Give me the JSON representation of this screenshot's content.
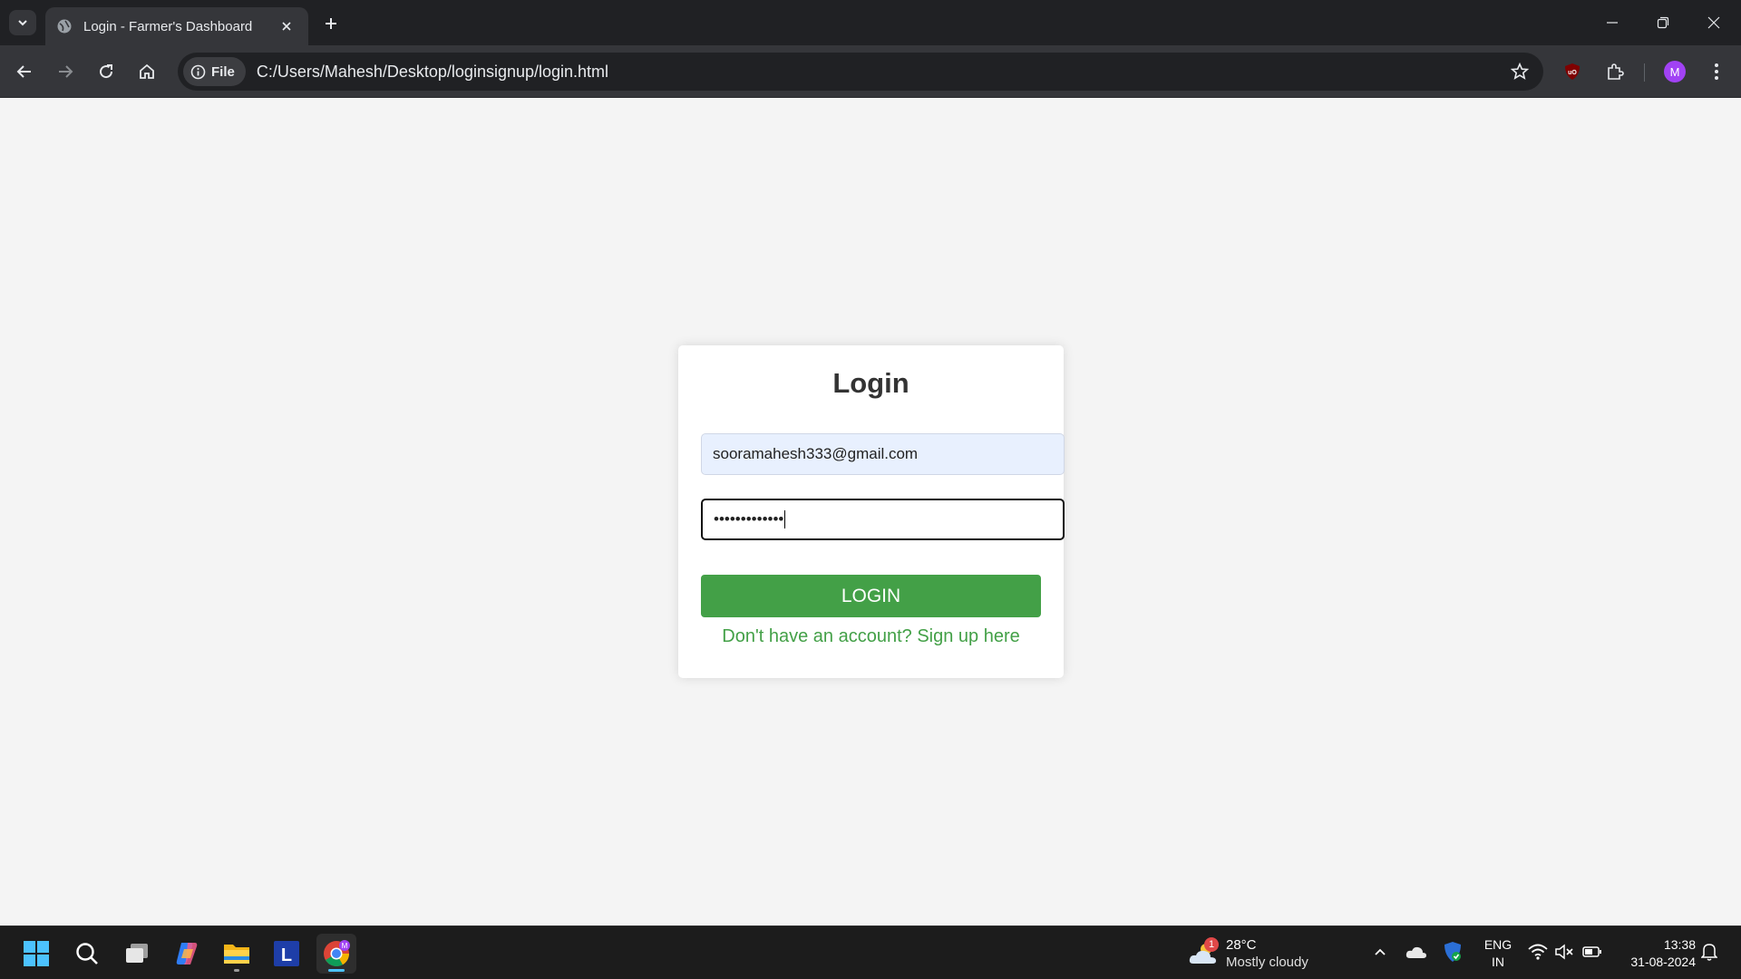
{
  "browser": {
    "tab_title": "Login - Farmer's Dashboard",
    "site_chip_label": "File",
    "url": "C:/Users/Mahesh/Desktop/loginsignup/login.html",
    "profile_initial": "M"
  },
  "login": {
    "title": "Login",
    "email_value": "sooramahesh333@gmail.com",
    "password_masked": "•••••••••••••",
    "button_label": "LOGIN",
    "signup_link": "Don't have an account? Sign up here"
  },
  "taskbar": {
    "weather_temp": "28°C",
    "weather_desc": "Mostly cloudy",
    "weather_badge": "1",
    "lang_line1": "ENG",
    "lang_line2": "IN",
    "time": "13:38",
    "date": "31-08-2024",
    "calendar_icon_letter": "L"
  },
  "colors": {
    "accent_green": "#43a047",
    "page_bg": "#f4f4f4",
    "browser_dark": "#202124"
  }
}
